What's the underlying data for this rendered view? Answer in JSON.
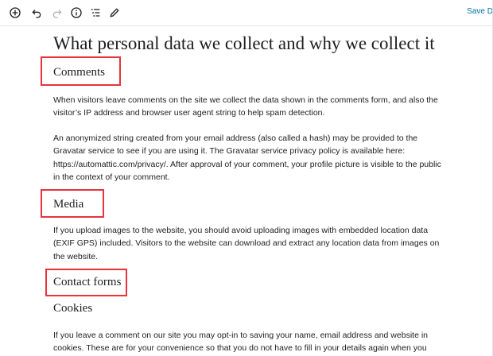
{
  "toolbar": {
    "items": [
      {
        "name": "add-block",
        "icon": "plus-circle-icon"
      },
      {
        "name": "undo",
        "icon": "undo-icon"
      },
      {
        "name": "redo",
        "icon": "redo-icon"
      },
      {
        "name": "info",
        "icon": "info-icon"
      },
      {
        "name": "outline",
        "icon": "list-icon"
      },
      {
        "name": "edit",
        "icon": "pencil-icon"
      }
    ],
    "save_label": "Save D"
  },
  "document": {
    "title": "What personal data we collect and why we collect it",
    "sections": {
      "comments": {
        "heading": "Comments",
        "p1": "When visitors leave comments on the site we collect the data shown in the comments form, and also the visitor’s IP address and browser user agent string to help spam detection.",
        "p2": "An anonymized string created from your email address (also called a hash) may be provided to the Gravatar service to see if you are using it. The Gravatar service privacy policy is available here: https://automattic.com/privacy/. After approval of your comment, your profile picture is visible to the public in the context of your comment."
      },
      "media": {
        "heading": "Media",
        "p1": "If you upload images to the website, you should avoid uploading images with embedded location data (EXIF GPS) included. Visitors to the website can download and extract any location data from images on the website."
      },
      "contact_forms": {
        "heading": "Contact forms"
      },
      "cookies": {
        "heading": "Cookies",
        "p1": "If you leave a comment on our site you may opt-in to saving your name, email address and website in cookies. These are for your convenience so that you do not have to fill in your details again when you"
      }
    }
  },
  "colors": {
    "highlight": "#e8323c",
    "accent": "#0073aa",
    "text": "#1e1e1e"
  }
}
